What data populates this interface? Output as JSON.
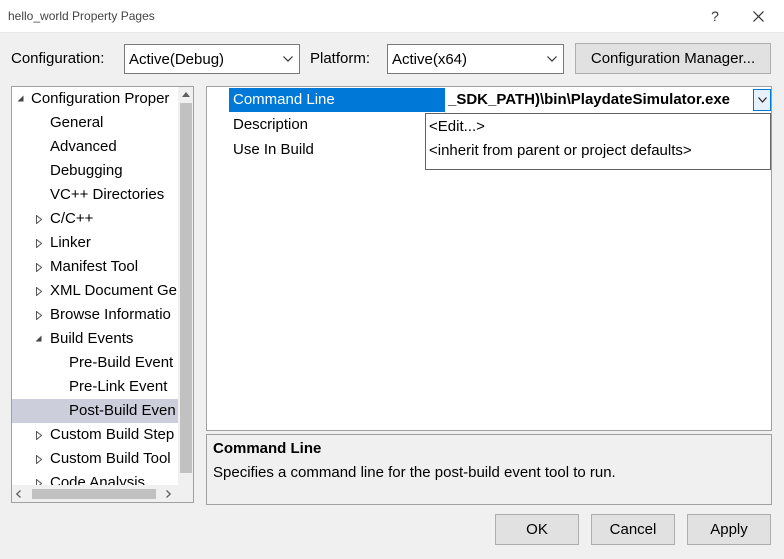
{
  "window": {
    "title": "hello_world Property Pages",
    "help_label": "?"
  },
  "config_row": {
    "configuration_label": "Configuration:",
    "configuration_value": "Active(Debug)",
    "platform_label": "Platform:",
    "platform_value": "Active(x64)",
    "manager_button": "Configuration Manager..."
  },
  "tree": {
    "items": [
      {
        "label": "Configuration Proper",
        "expander": "expanded"
      },
      {
        "label": "General",
        "expander": "none"
      },
      {
        "label": "Advanced",
        "expander": "none"
      },
      {
        "label": "Debugging",
        "expander": "none"
      },
      {
        "label": "VC++ Directories",
        "expander": "none"
      },
      {
        "label": "C/C++",
        "expander": "collapsed"
      },
      {
        "label": "Linker",
        "expander": "collapsed"
      },
      {
        "label": "Manifest Tool",
        "expander": "collapsed"
      },
      {
        "label": "XML Document Ge",
        "expander": "collapsed"
      },
      {
        "label": "Browse Informatio",
        "expander": "collapsed"
      },
      {
        "label": "Build Events",
        "expander": "expanded"
      },
      {
        "label": "Pre-Build Event",
        "expander": "none"
      },
      {
        "label": "Pre-Link Event",
        "expander": "none"
      },
      {
        "label": "Post-Build Even",
        "expander": "none",
        "selected": true
      },
      {
        "label": "Custom Build Step",
        "expander": "collapsed"
      },
      {
        "label": "Custom Build Tool",
        "expander": "collapsed"
      },
      {
        "label": "Code Analysis",
        "expander": "collapsed"
      }
    ]
  },
  "grid": {
    "rows": [
      {
        "name": "Command Line",
        "value": "_SDK_PATH)\\bin\\PlaydateSimulator.exe"
      },
      {
        "name": "Description",
        "value": ""
      },
      {
        "name": "Use In Build",
        "value": ""
      }
    ]
  },
  "dropdown": {
    "options": [
      "<Edit...>",
      "<inherit from parent or project defaults>"
    ]
  },
  "description": {
    "title": "Command Line",
    "text": "Specifies a command line for the post-build event tool to run."
  },
  "buttons": {
    "ok": "OK",
    "cancel": "Cancel",
    "apply": "Apply"
  },
  "colors": {
    "selection": "#0078d7",
    "tree_selection": "#cccedb",
    "background": "#f0f0f0"
  }
}
